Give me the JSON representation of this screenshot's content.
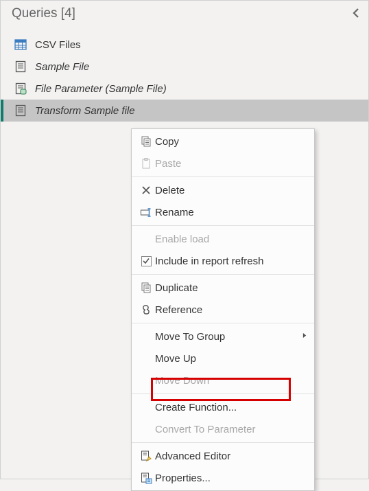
{
  "pane": {
    "title": "Queries [4]"
  },
  "queries": [
    {
      "label": "CSV Files",
      "italic": false
    },
    {
      "label": "Sample File",
      "italic": true
    },
    {
      "label": "File Parameter (Sample File)",
      "italic": true
    },
    {
      "label": "Transform Sample file",
      "italic": true
    }
  ],
  "context_menu": {
    "copy": "Copy",
    "paste": "Paste",
    "delete": "Delete",
    "rename": "Rename",
    "enable_load": "Enable load",
    "include_refresh": "Include in report refresh",
    "duplicate": "Duplicate",
    "reference": "Reference",
    "move_to_group": "Move To Group",
    "move_up": "Move Up",
    "move_down": "Move Down",
    "create_function": "Create Function...",
    "convert_to_parameter": "Convert To Parameter",
    "advanced_editor": "Advanced Editor",
    "properties": "Properties..."
  }
}
